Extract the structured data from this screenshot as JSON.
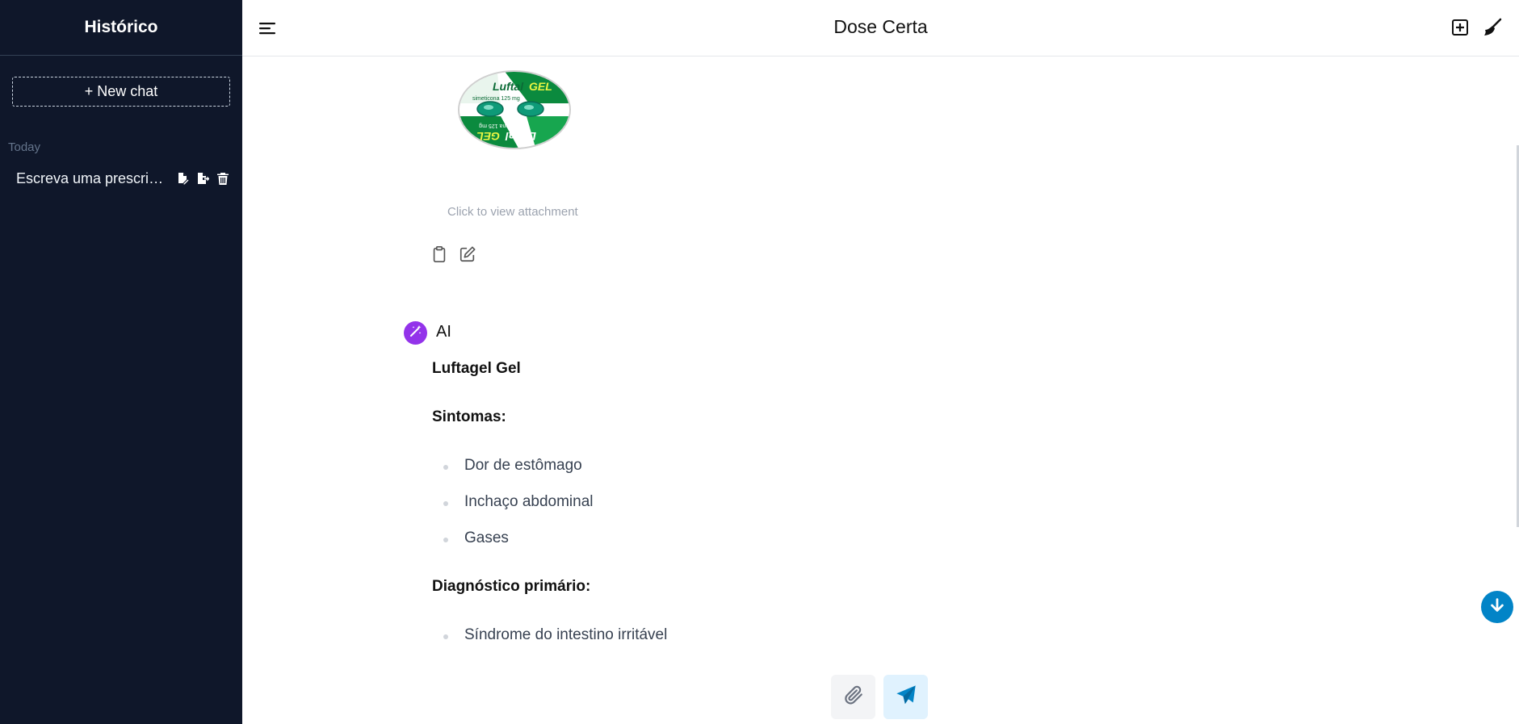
{
  "sidebar": {
    "title": "Histórico",
    "new_chat_label": "+ New chat",
    "section_label": "Today",
    "history": [
      {
        "label": "Escreva uma prescrição..."
      }
    ]
  },
  "header": {
    "title": "Dose Certa"
  },
  "attachment": {
    "caption": "Click to view attachment",
    "image_brand_text": "Luftal GEL",
    "image_sub_text": "simeticona 125 mg"
  },
  "ai_message": {
    "author": "AI",
    "heading": "Luftagel Gel",
    "symptoms_heading": "Sintomas:",
    "symptoms": [
      "Dor de estômago",
      "Inchaço abdominal",
      "Gases"
    ],
    "diagnosis_heading": "Diagnóstico primário:",
    "diagnoses": [
      "Síndrome do intestino irritável"
    ]
  },
  "colors": {
    "sidebar_bg": "#0f172a",
    "ai_avatar": "#9333ea",
    "accent": "#0284c7"
  }
}
